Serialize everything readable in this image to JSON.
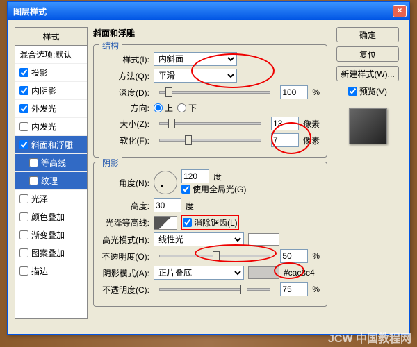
{
  "window": {
    "title": "图层样式",
    "close": "×"
  },
  "left": {
    "header": "样式",
    "blend": "混合选项:默认",
    "items": [
      "投影",
      "内阴影",
      "外发光",
      "内发光",
      "斜面和浮雕",
      "等高线",
      "纹理",
      "光泽",
      "颜色叠加",
      "渐变叠加",
      "图案叠加",
      "描边"
    ]
  },
  "struct": {
    "group_title": "斜面和浮雕",
    "section": "结构",
    "style_lbl": "样式(I):",
    "style_val": "内斜面",
    "method_lbl": "方法(Q):",
    "method_val": "平滑",
    "depth_lbl": "深度(D):",
    "depth_val": "100",
    "pct": "%",
    "dir_lbl": "方向:",
    "up": "上",
    "down": "下",
    "size_lbl": "大小(Z):",
    "size_val": "13",
    "px": "像素",
    "soften_lbl": "软化(F):",
    "soften_val": "7"
  },
  "shade": {
    "section": "阴影",
    "angle_lbl": "角度(N):",
    "angle_val": "120",
    "deg": "度",
    "global": "使用全局光(G)",
    "alt_lbl": "高度:",
    "alt_val": "30",
    "gloss_lbl": "光泽等高线:",
    "anti": "消除锯齿(L)",
    "hl_lbl": "高光模式(H):",
    "hl_val": "线性光",
    "op_lbl": "不透明度(O):",
    "op_val": "50",
    "sh_lbl": "阴影模式(A):",
    "sh_val": "正片叠底",
    "sh_color": "#cac8c4",
    "op2_lbl": "不透明度(C):",
    "op2_val": "75"
  },
  "right": {
    "ok": "确定",
    "reset": "复位",
    "newstyle": "新建样式(W)...",
    "preview": "预览(V)"
  },
  "watermark": "JCW 中国教程网"
}
